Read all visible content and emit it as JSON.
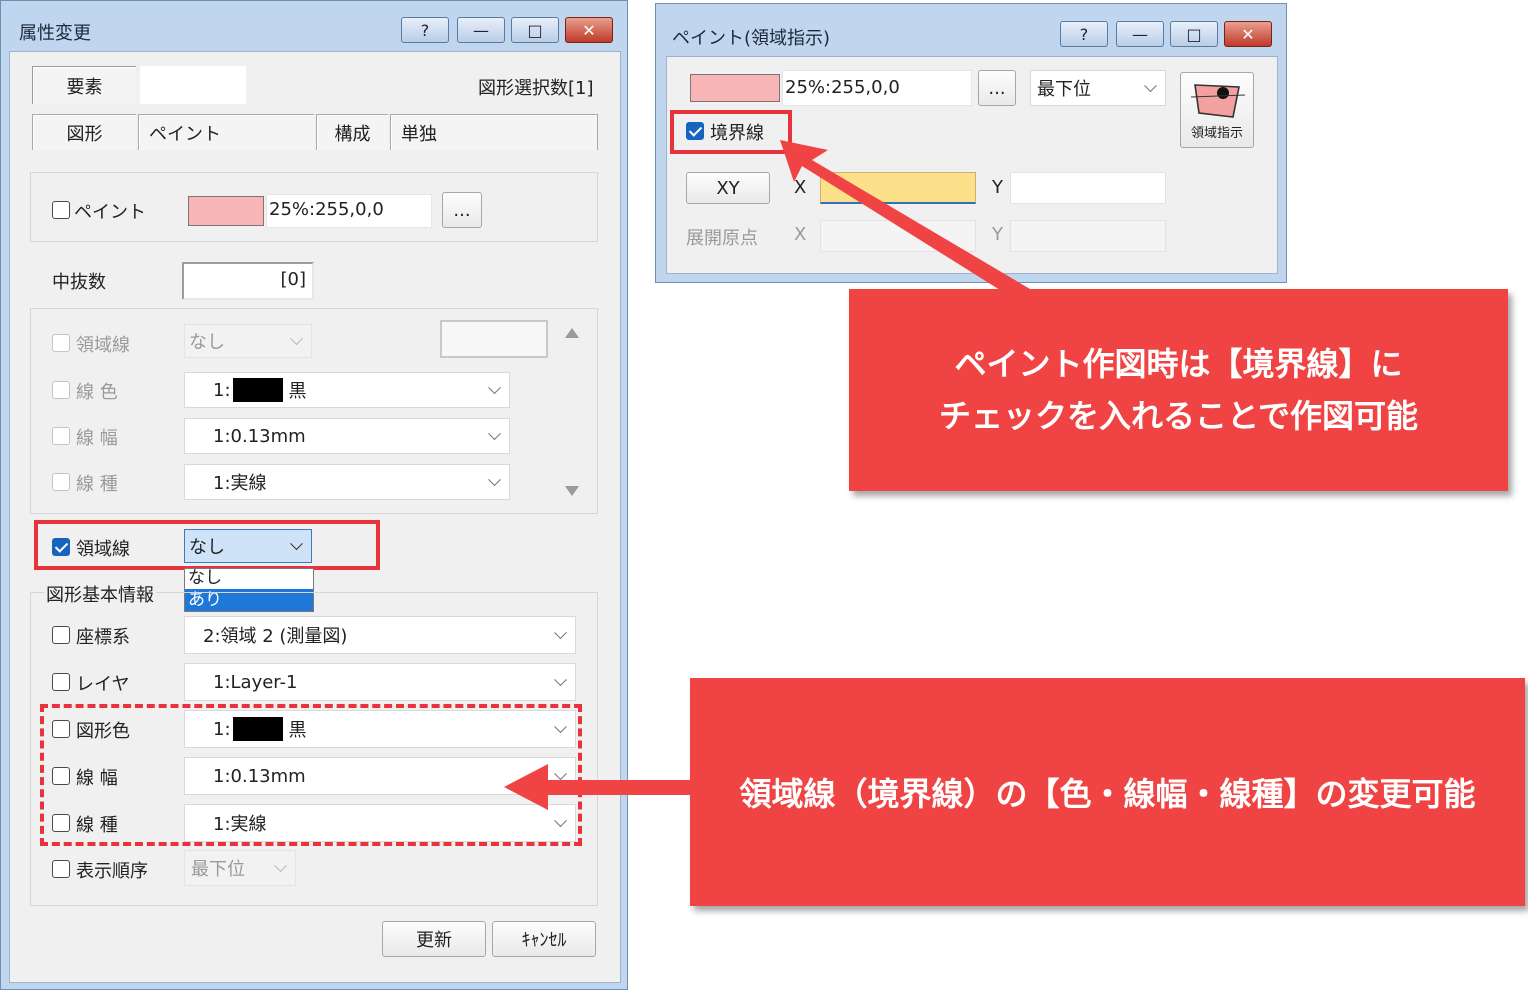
{
  "main": {
    "title": "属性変更",
    "caption_buttons": [
      "?",
      "—",
      "□",
      "✕"
    ],
    "tabs_row1": {
      "element": "要素",
      "selection_count": "図形選択数[1]"
    },
    "tabs_row2": [
      "図形",
      "ペイント",
      "構成",
      "単独"
    ],
    "paint": {
      "label": "ペイント",
      "value": "25%:255,0,0",
      "button": "...",
      "color": "#f9b5b5"
    },
    "nakanuki": {
      "label": "中抜数",
      "value": "[0]"
    },
    "region_group": {
      "region_line": {
        "label": "領域線",
        "value": "なし"
      },
      "line_color": {
        "label": "線 色",
        "prefix": "1:",
        "name": "黒"
      },
      "line_width": {
        "label": "線 幅",
        "value": "1:0.13mm"
      },
      "line_type": {
        "label": "線 種",
        "value": "1:実線"
      }
    },
    "region_line_active": {
      "label": "領域線",
      "value": "なし",
      "options": [
        "なし",
        "あり"
      ]
    },
    "basic_info": {
      "legend": "図形基本情報",
      "coord": {
        "label": "座標系",
        "value": "2:領域 2 (測量図)"
      },
      "layer": {
        "label": "レイヤ",
        "value": "1:Layer-1"
      },
      "shape_color": {
        "label": "図形色",
        "prefix": "1:",
        "name": "黒"
      },
      "line_width": {
        "label": "線 幅",
        "value": "1:0.13mm"
      },
      "line_type": {
        "label": "線 種",
        "value": "1:実線"
      },
      "order": {
        "label": "表示順序",
        "value": "最下位"
      }
    },
    "buttons": {
      "update": "更新",
      "cancel": "ｷｬﾝｾﾙ"
    }
  },
  "paint_window": {
    "title": "ペイント(領域指示)",
    "caption_buttons": [
      "?",
      "—",
      "□",
      "✕"
    ],
    "paint_value": "25%:255,0,0",
    "button": "...",
    "order": "最下位",
    "region_button": "領域指示",
    "boundary": {
      "label": "境界線",
      "checked": true
    },
    "xy_button": "XY",
    "x_label": "X",
    "y_label": "Y",
    "origin_label": "展開原点"
  },
  "callouts": {
    "top_line1": "ペイント作図時は【境界線】に",
    "top_line2": "チェックを入れることで作図可能",
    "bottom": "領域線（境界線）の【色・線幅・線種】の変更可能"
  },
  "colors": {
    "callout": "#f04444",
    "highlight": "#e8323c",
    "yellow": "#fde08a",
    "paint": "#f9b5b5",
    "window": "#bfd6ee"
  }
}
